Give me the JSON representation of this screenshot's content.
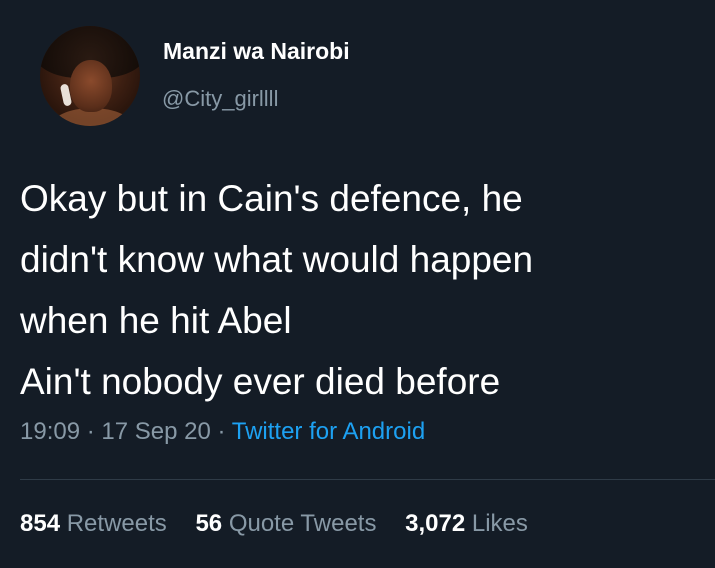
{
  "author": {
    "name": "Manzi wa Nairobi",
    "handle": "@City_girllll"
  },
  "tweet": {
    "lines": [
      "Okay but in Cain's defence, he",
      "didn't know what would happen",
      "when he hit Abel",
      "Ain't nobody ever died before"
    ],
    "time": "19:09",
    "date": "17 Sep 20",
    "separator": "·",
    "source": "Twitter for Android"
  },
  "stats": {
    "retweets_count": "854",
    "retweets_label": "Retweets",
    "quotes_count": "56",
    "quotes_label": "Quote Tweets",
    "likes_count": "3,072",
    "likes_label": "Likes"
  },
  "colors": {
    "background": "#141c26",
    "primary_text": "#ffffff",
    "secondary_text": "#8899a6",
    "link": "#1da1f2"
  }
}
